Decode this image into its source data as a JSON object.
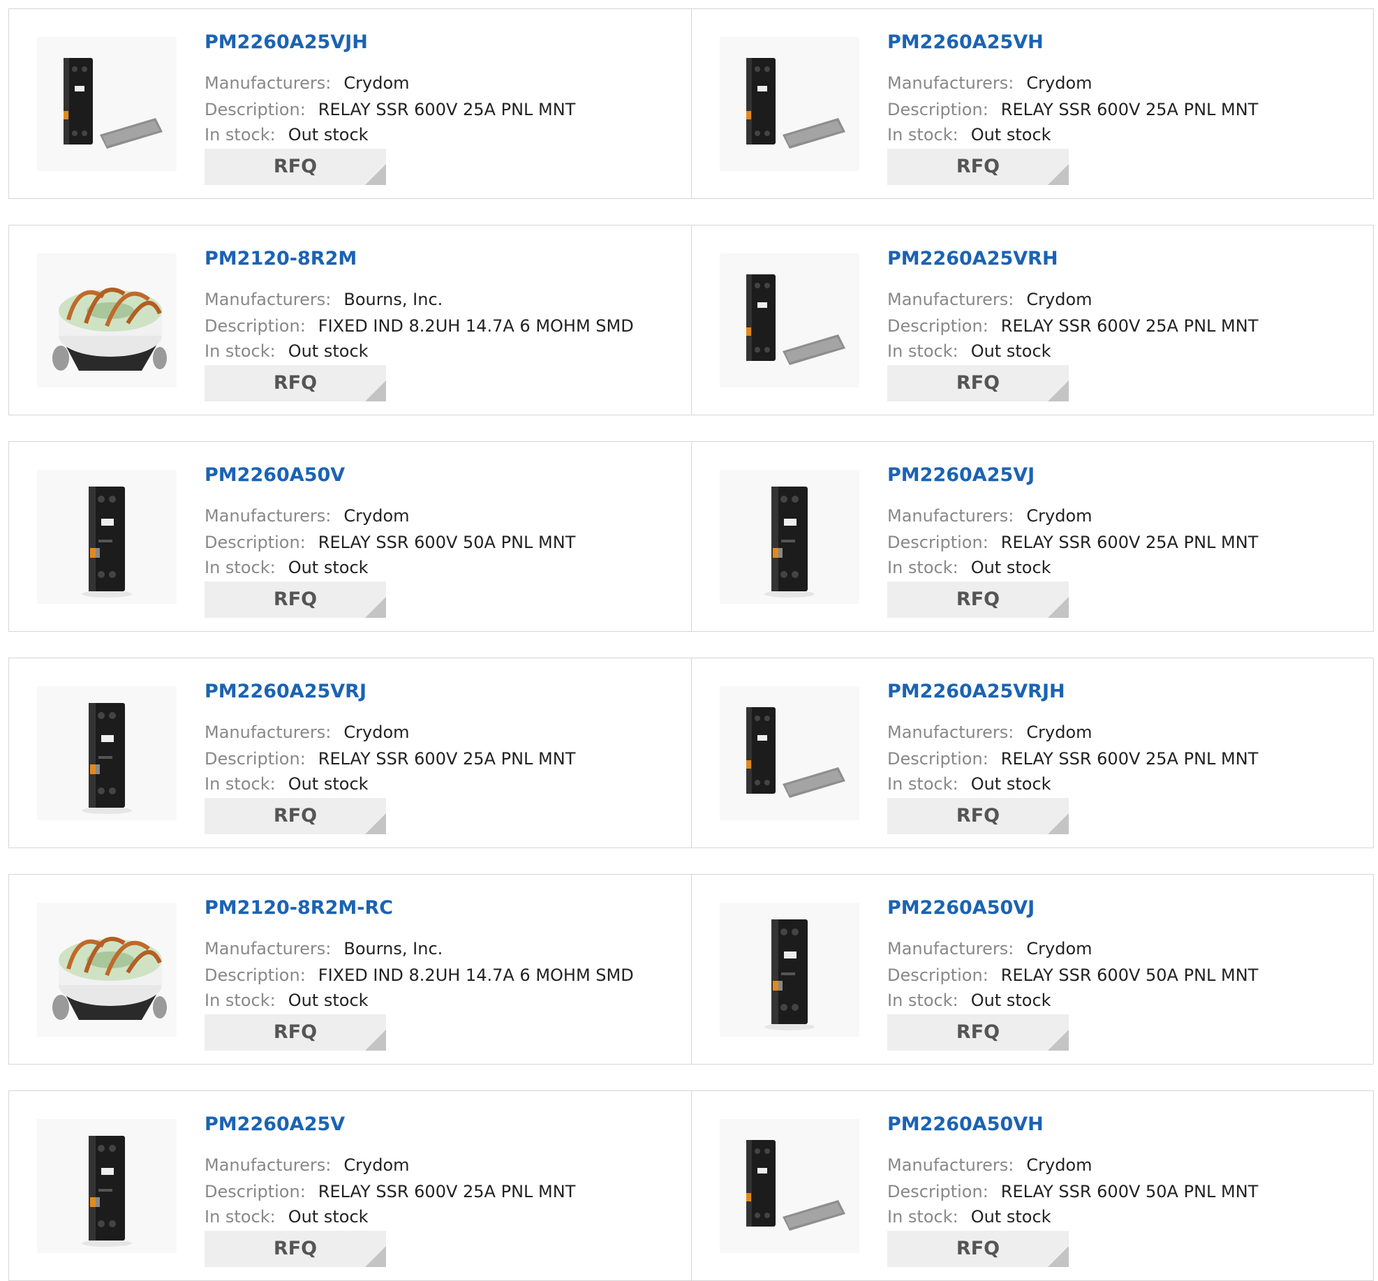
{
  "labels": {
    "manufacturers": "Manufacturers:",
    "description": "Description:",
    "in_stock": "In stock:",
    "rfq": "RFQ"
  },
  "colors": {
    "title": "#1b63b3",
    "label": "#888888",
    "value": "#222222",
    "button_bg": "#eeeeee",
    "border": "#d6d6d6"
  },
  "products": [
    {
      "part": "PM2260A25VJH",
      "manufacturer": "Crydom",
      "description": "RELAY SSR 600V 25A PNL MNT",
      "stock": "Out stock",
      "image": "relay-with-pad"
    },
    {
      "part": "PM2260A25VH",
      "manufacturer": "Crydom",
      "description": "RELAY SSR 600V 25A PNL MNT",
      "stock": "Out stock",
      "image": "relay-with-pad"
    },
    {
      "part": "PM2120-8R2M",
      "manufacturer": "Bourns, Inc.",
      "description": "FIXED IND 8.2UH 14.7A 6 MOHM SMD",
      "stock": "Out stock",
      "image": "toroid-inductor"
    },
    {
      "part": "PM2260A25VRH",
      "manufacturer": "Crydom",
      "description": "RELAY SSR 600V 25A PNL MNT",
      "stock": "Out stock",
      "image": "relay-with-pad"
    },
    {
      "part": "PM2260A50V",
      "manufacturer": "Crydom",
      "description": "RELAY SSR 600V 50A PNL MNT",
      "stock": "Out stock",
      "image": "relay"
    },
    {
      "part": "PM2260A25VJ",
      "manufacturer": "Crydom",
      "description": "RELAY SSR 600V 25A PNL MNT",
      "stock": "Out stock",
      "image": "relay"
    },
    {
      "part": "PM2260A25VRJ",
      "manufacturer": "Crydom",
      "description": "RELAY SSR 600V 25A PNL MNT",
      "stock": "Out stock",
      "image": "relay"
    },
    {
      "part": "PM2260A25VRJH",
      "manufacturer": "Crydom",
      "description": "RELAY SSR 600V 25A PNL MNT",
      "stock": "Out stock",
      "image": "relay-with-pad"
    },
    {
      "part": "PM2120-8R2M-RC",
      "manufacturer": "Bourns, Inc.",
      "description": "FIXED IND 8.2UH 14.7A 6 MOHM SMD",
      "stock": "Out stock",
      "image": "toroid-inductor"
    },
    {
      "part": "PM2260A50VJ",
      "manufacturer": "Crydom",
      "description": "RELAY SSR 600V 50A PNL MNT",
      "stock": "Out stock",
      "image": "relay"
    },
    {
      "part": "PM2260A25V",
      "manufacturer": "Crydom",
      "description": "RELAY SSR 600V 25A PNL MNT",
      "stock": "Out stock",
      "image": "relay"
    },
    {
      "part": "PM2260A50VH",
      "manufacturer": "Crydom",
      "description": "RELAY SSR 600V 50A PNL MNT",
      "stock": "Out stock",
      "image": "relay-with-pad"
    }
  ]
}
